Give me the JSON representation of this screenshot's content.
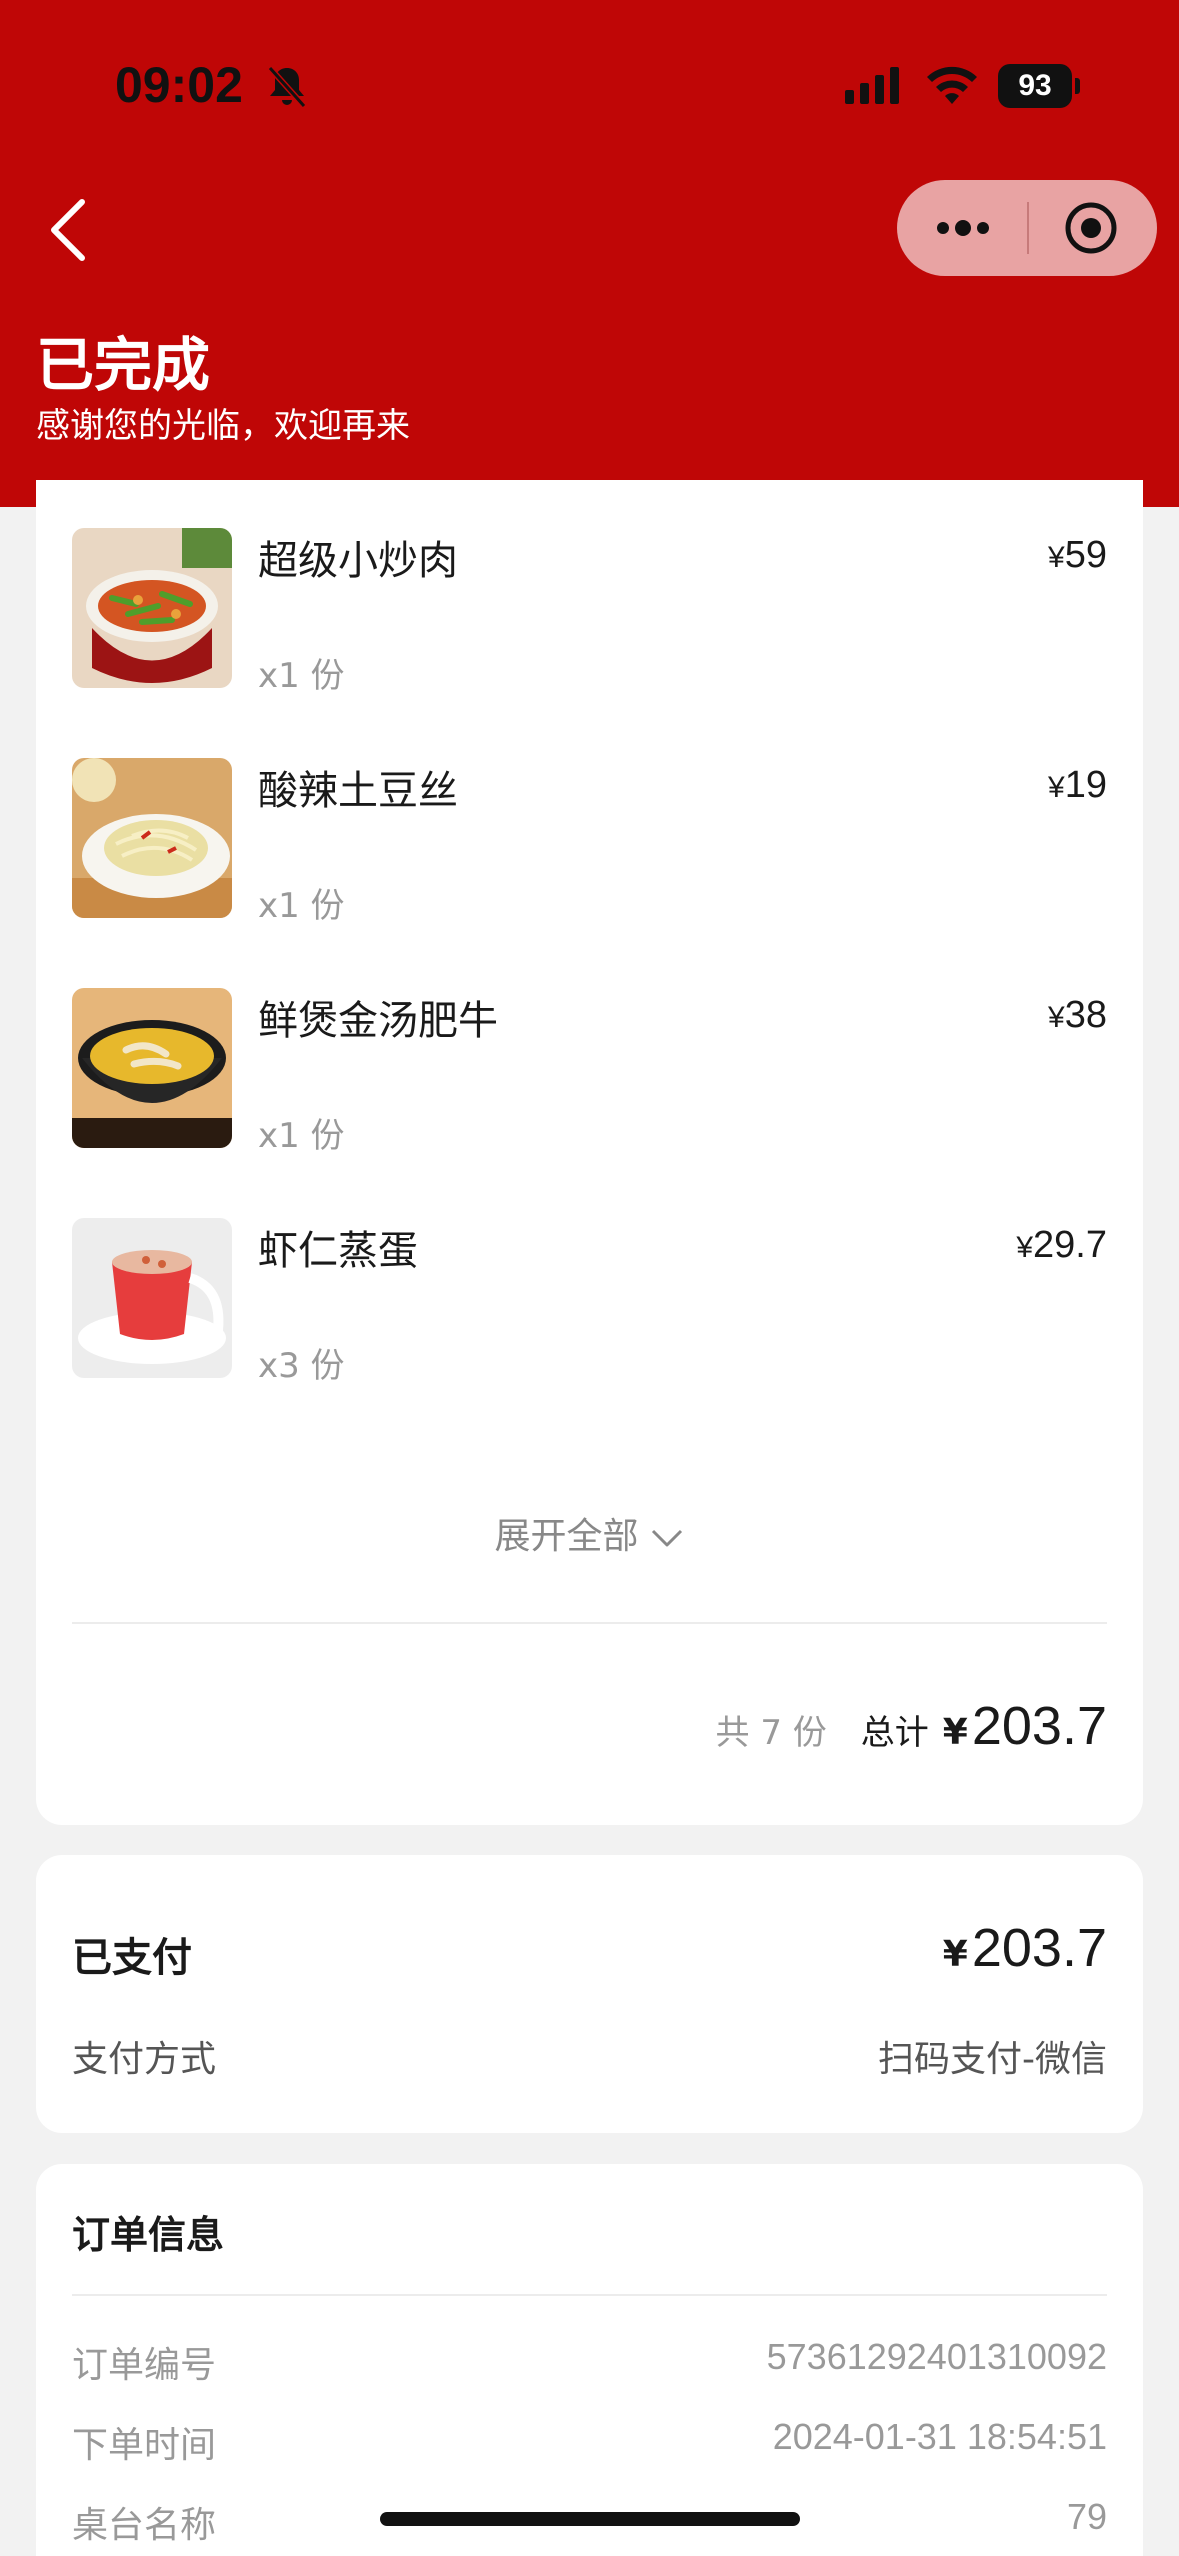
{
  "status_bar": {
    "time": "09:02",
    "battery": "93"
  },
  "header": {
    "title": "已完成",
    "subtitle": "感谢您的光临，欢迎再来"
  },
  "items": [
    {
      "name": "超级小炒肉",
      "qty": "x1 份",
      "currency": "¥",
      "price": "59"
    },
    {
      "name": "酸辣土豆丝",
      "qty": "x1 份",
      "currency": "¥",
      "price": "19"
    },
    {
      "name": "鲜煲金汤肥牛",
      "qty": "x1 份",
      "currency": "¥",
      "price": "38"
    },
    {
      "name": "虾仁蒸蛋",
      "qty": "x3 份",
      "currency": "¥",
      "price": "29.7"
    }
  ],
  "expand_label": "展开全部",
  "summary": {
    "count": "共 7 份",
    "total_label": "总计",
    "currency": "¥",
    "total": "203.7"
  },
  "payment": {
    "status": "已支付",
    "currency": "¥",
    "amount": "203.7",
    "method_label": "支付方式",
    "method_value": "扫码支付-微信"
  },
  "order_info": {
    "title": "订单信息",
    "rows": [
      {
        "label": "订单编号",
        "value": "57361292401310092"
      },
      {
        "label": "下单时间",
        "value": "2024-01-31 18:54:51"
      },
      {
        "label": "桌台名称",
        "value": "79"
      }
    ]
  },
  "colors": {
    "header_bg": "#bf0606",
    "page_bg": "#f2f2f2"
  },
  "icons": [
    "bell-off-icon",
    "signal-icon",
    "wifi-icon",
    "battery-icon",
    "back-icon",
    "more-icon",
    "target-icon",
    "chevron-down-icon"
  ]
}
